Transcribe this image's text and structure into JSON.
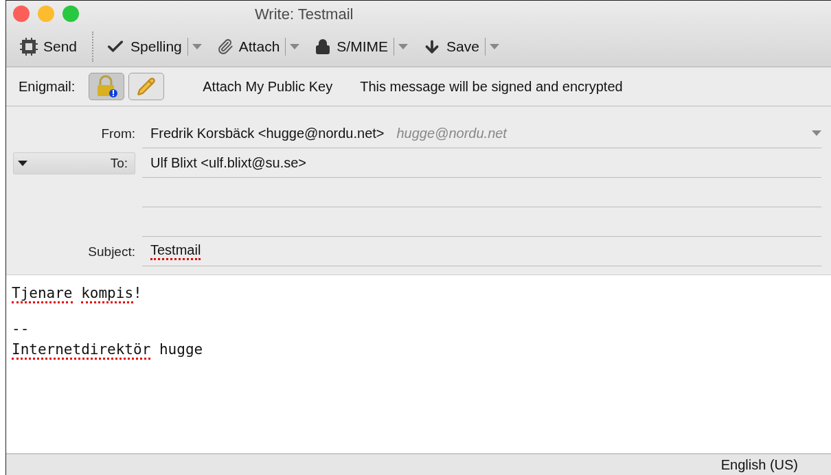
{
  "window": {
    "title": "Write: Testmail"
  },
  "toolbar": [
    {
      "label": "Send",
      "kind": "send",
      "menu": false
    },
    {
      "label": "Spelling",
      "kind": "check",
      "menu": true
    },
    {
      "label": "Attach",
      "kind": "clip",
      "menu": true
    },
    {
      "label": "S/MIME",
      "kind": "lock",
      "menu": true
    },
    {
      "label": "Save",
      "kind": "save",
      "menu": true
    }
  ],
  "enigmail": {
    "label": "Enigmail:",
    "buttons": [
      {
        "kind": "encrypt",
        "pressed": true
      },
      {
        "kind": "sign",
        "pressed": false
      }
    ],
    "attach_key": "Attach My Public Key",
    "status": "This message will be signed and encrypted"
  },
  "header": {
    "from": {
      "label": "From:",
      "value": "Fredrik Korsbäck <hugge@nordu.net>",
      "identity": "hugge@nordu.net"
    },
    "recipients": [
      {
        "label": "To:",
        "value": "Ulf Blixt <ulf.blixt@su.se>"
      }
    ],
    "subject": {
      "label": "Subject:",
      "value": "Testmail",
      "misspelled": true
    }
  },
  "body": {
    "paragraphs": [
      [
        [
          {
            "text": "Tjenare",
            "misspelled": true
          },
          {
            "text": "kompis",
            "misspelled": true,
            "space_before": true
          },
          {
            "text": "!",
            "misspelled": false
          }
        ]
      ],
      [
        [
          {
            "text": "--",
            "misspelled": false
          }
        ],
        [
          {
            "text": "Internetdirektör",
            "misspelled": true
          },
          {
            "text": "hugge",
            "misspelled": false,
            "space_before": true
          }
        ]
      ]
    ]
  },
  "status_bar": {
    "language": "English (US)"
  }
}
